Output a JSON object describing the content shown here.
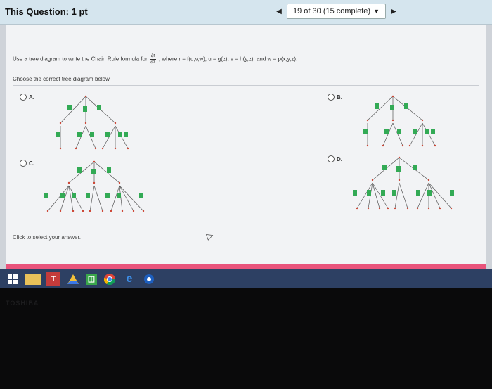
{
  "header": {
    "question_label": "This Question: 1 pt",
    "progress_label": "19 of 30 (15 complete)"
  },
  "question": {
    "prefix": "Use a tree diagram to write the Chain Rule formula for",
    "frac_num": "∂r",
    "frac_den": "∂z",
    "suffix": ", where r = f(u,v,w), u = g(z), v = h(y,z), and w = p(x,y,z)."
  },
  "choose_text": "Choose the correct tree diagram below.",
  "options": [
    {
      "letter": "A."
    },
    {
      "letter": "B."
    },
    {
      "letter": "C."
    },
    {
      "letter": "D."
    }
  ],
  "footer": {
    "click_text": "Click to select your answer."
  },
  "laptop": {
    "brand": "TOSHIBA"
  },
  "colors": {
    "accent_strip": "#e9537b",
    "taskbar": "#2d4063"
  },
  "icons": [
    "windows-icon",
    "file-explorer-icon",
    "t-app-icon",
    "google-drive-icon",
    "store-icon",
    "chrome-icon",
    "edge-icon",
    "media-icon"
  ]
}
